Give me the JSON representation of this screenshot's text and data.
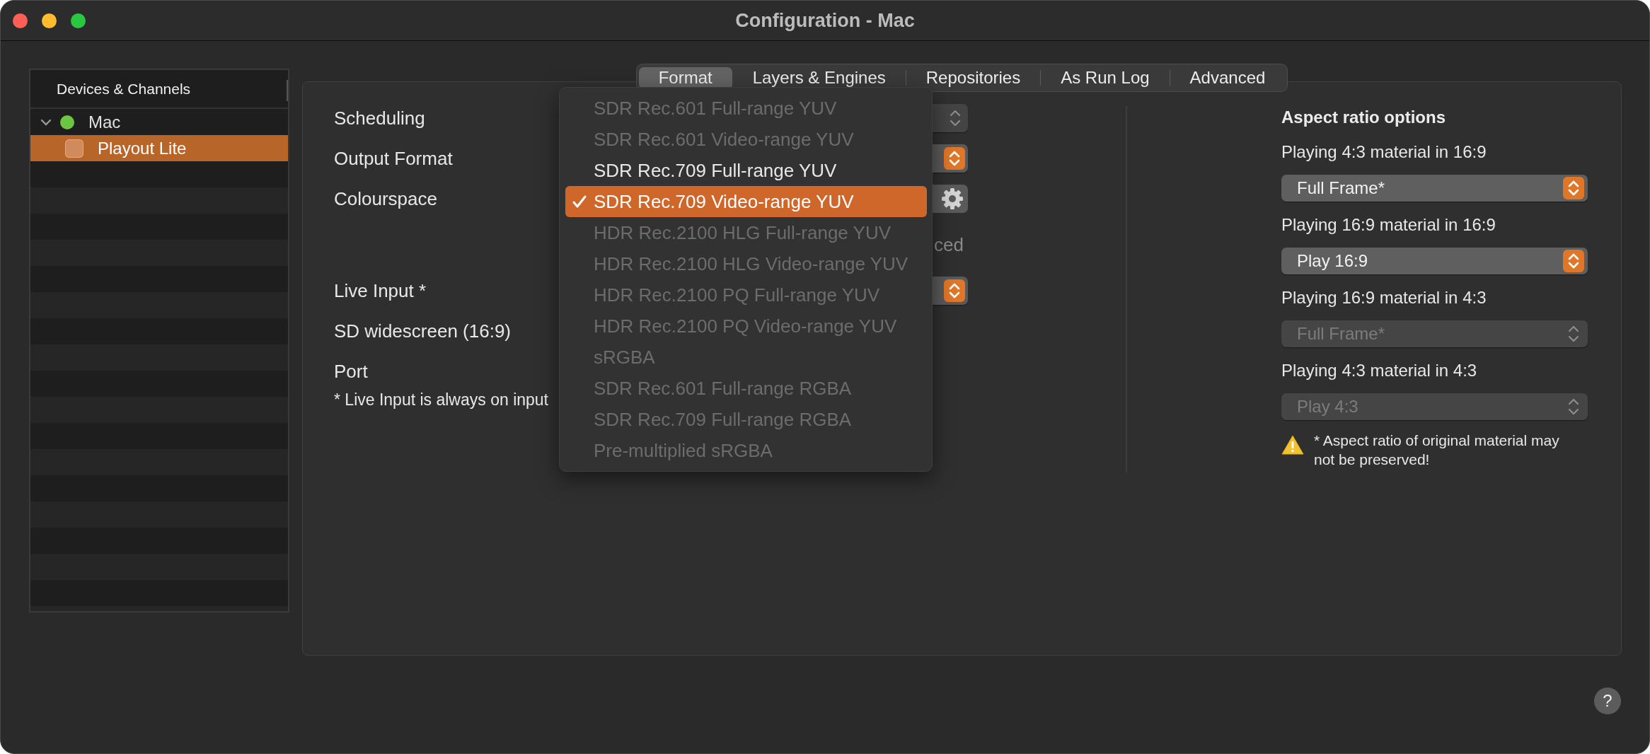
{
  "window": {
    "title": "Configuration - Mac"
  },
  "sidebar": {
    "header": "Devices & Channels",
    "items": [
      {
        "label": "Mac",
        "expanded": true,
        "selected": false,
        "color": "#6cc644",
        "children": [
          {
            "label": "Playout Lite",
            "selected": true
          }
        ]
      }
    ]
  },
  "tabs": [
    {
      "label": "Format",
      "selected": true
    },
    {
      "label": "Layers & Engines",
      "selected": false
    },
    {
      "label": "Repositories",
      "selected": false
    },
    {
      "label": "As Run Log",
      "selected": false
    },
    {
      "label": "Advanced",
      "selected": false
    }
  ],
  "format": {
    "fields": [
      {
        "kind": "popup",
        "label": "Scheduling",
        "disabled": true
      },
      {
        "kind": "popup",
        "label": "Output Format",
        "disabled": false
      },
      {
        "kind": "gear",
        "label": "Colourspace"
      },
      {
        "kind": "text",
        "value": "ced"
      },
      {
        "kind": "popup",
        "label": "Live Input *",
        "disabled": false
      },
      {
        "kind": "label",
        "label": "SD widescreen (16:9)"
      },
      {
        "kind": "label",
        "label": "Port"
      }
    ],
    "note": "* Live Input is always on input"
  },
  "menu": {
    "items": [
      {
        "label": "SDR Rec.601 Full-range YUV",
        "disabled": true,
        "selected": false
      },
      {
        "label": "SDR Rec.601 Video-range YUV",
        "disabled": true,
        "selected": false
      },
      {
        "label": "SDR Rec.709 Full-range YUV",
        "disabled": false,
        "selected": false
      },
      {
        "label": "SDR Rec.709 Video-range YUV",
        "disabled": false,
        "selected": true
      },
      {
        "label": "HDR Rec.2100 HLG Full-range YUV",
        "disabled": true,
        "selected": false
      },
      {
        "label": "HDR Rec.2100 HLG Video-range YUV",
        "disabled": true,
        "selected": false
      },
      {
        "label": "HDR Rec.2100 PQ Full-range YUV",
        "disabled": true,
        "selected": false
      },
      {
        "label": "HDR Rec.2100 PQ Video-range YUV",
        "disabled": true,
        "selected": false
      },
      {
        "label": "sRGBA",
        "disabled": true,
        "selected": false
      },
      {
        "label": "SDR Rec.601 Full-range RGBA",
        "disabled": true,
        "selected": false
      },
      {
        "label": "SDR Rec.709 Full-range RGBA",
        "disabled": true,
        "selected": false
      },
      {
        "label": "Pre-multiplied sRGBA",
        "disabled": true,
        "selected": false
      }
    ]
  },
  "aspect": {
    "title": "Aspect ratio options",
    "options": [
      {
        "label": "Playing 4:3 material in 16:9",
        "value": "Full Frame*",
        "disabled": false
      },
      {
        "label": "Playing 16:9 material in 16:9",
        "value": "Play 16:9",
        "disabled": false
      },
      {
        "label": "Playing 16:9 material in 4:3",
        "value": "Full Frame*",
        "disabled": true
      },
      {
        "label": "Playing 4:3 material in 4:3",
        "value": "Play 4:3",
        "disabled": true
      }
    ],
    "warning": "* Aspect ratio of original material may not be preserved!"
  },
  "help_button": "?"
}
